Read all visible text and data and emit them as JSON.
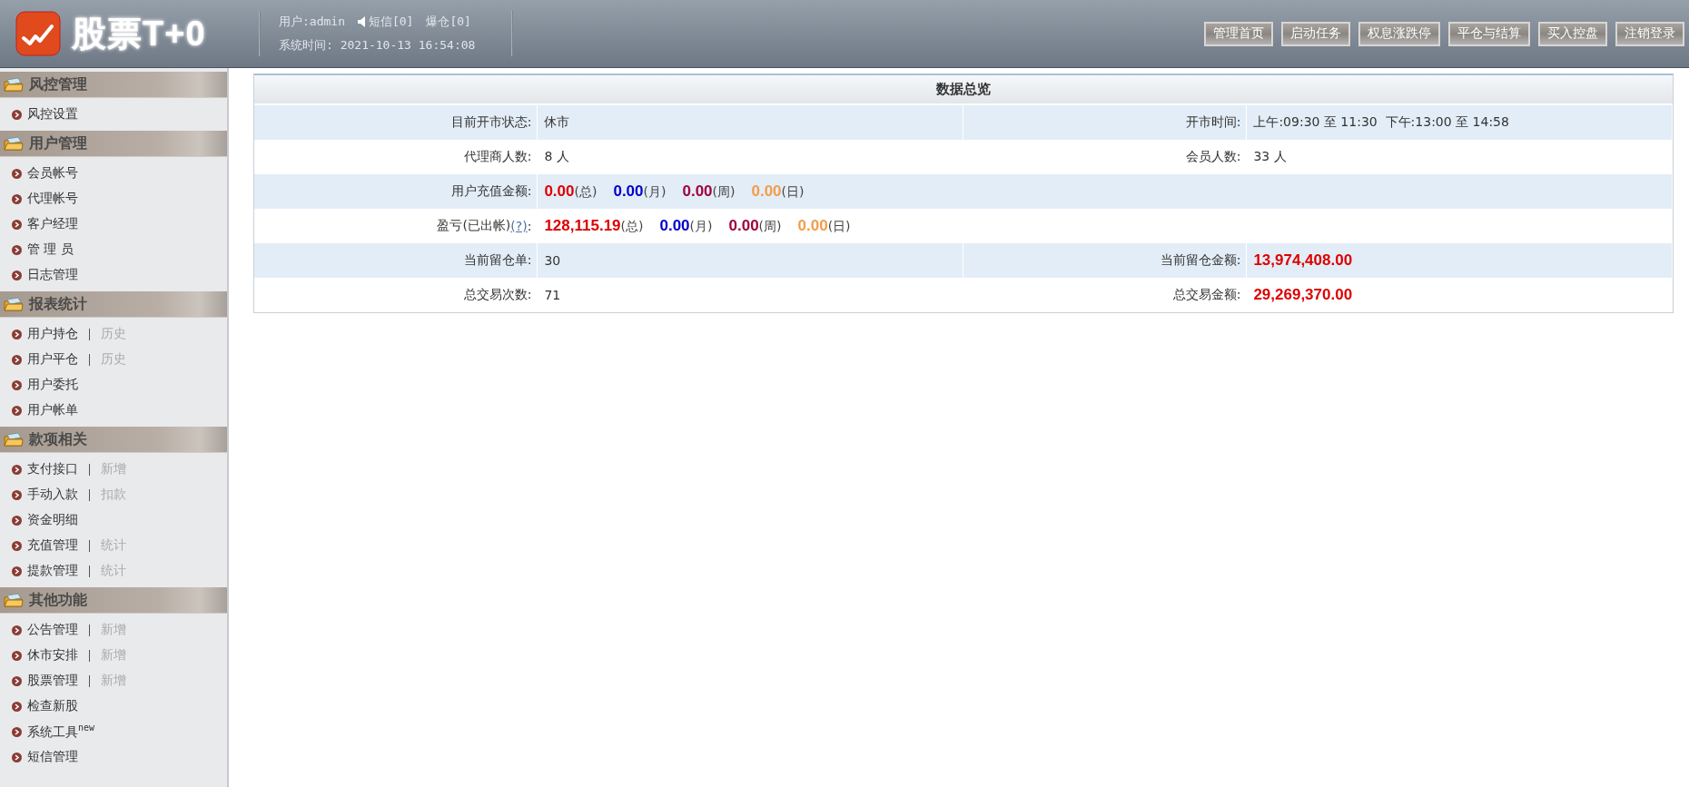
{
  "header": {
    "logo_text": "股票T+0",
    "user": "用户:admin",
    "messages": "短信[0]",
    "liquidations": "爆仓[0]",
    "system_time": "系统时间: 2021-10-13 16:54:08",
    "buttons": [
      "管理首页",
      "启动任务",
      "权息涨跌停",
      "平仓与结算",
      "买入控盘",
      "注销登录"
    ]
  },
  "sidebar": {
    "sections": [
      {
        "title": "风控管理",
        "items": [
          {
            "label": "风控设置"
          }
        ]
      },
      {
        "title": "用户管理",
        "items": [
          {
            "label": "会员帐号"
          },
          {
            "label": "代理帐号"
          },
          {
            "label": "客户经理"
          },
          {
            "label": "管 理 员"
          },
          {
            "label": "日志管理"
          }
        ]
      },
      {
        "title": "报表统计",
        "items": [
          {
            "label": "用户持仓",
            "extra": "历史"
          },
          {
            "label": "用户平仓",
            "extra": "历史"
          },
          {
            "label": "用户委托"
          },
          {
            "label": "用户帐单"
          }
        ]
      },
      {
        "title": "款项相关",
        "items": [
          {
            "label": "支付接口",
            "extra": "新增"
          },
          {
            "label": "手动入款",
            "extra": "扣款"
          },
          {
            "label": "资金明细"
          },
          {
            "label": "充值管理",
            "extra": "统计"
          },
          {
            "label": "提款管理",
            "extra": "统计"
          }
        ]
      },
      {
        "title": "其他功能",
        "items": [
          {
            "label": "公告管理",
            "extra": "新增"
          },
          {
            "label": "休市安排",
            "extra": "新增"
          },
          {
            "label": "股票管理",
            "extra": "新增"
          },
          {
            "label": "检查新股"
          },
          {
            "label": "系统工具$^{new}$"
          },
          {
            "label": "短信管理"
          }
        ]
      }
    ]
  },
  "overview": {
    "title": "数据总览",
    "rows": [
      {
        "kind": "pair",
        "cells": [
          {
            "label": "目前开市状态:",
            "value": {
              "kind": "text",
              "text": "休市"
            }
          },
          {
            "label": "开市时间:",
            "value": {
              "kind": "text",
              "text": "上午:09:30 至 11:30  下午:13:00 至 14:58"
            }
          }
        ]
      },
      {
        "kind": "pair",
        "cells": [
          {
            "label": "代理商人数:",
            "value": {
              "kind": "text",
              "text": "8 人"
            }
          },
          {
            "label": "会员人数:",
            "value": {
              "kind": "text",
              "text": "33 人"
            }
          }
        ]
      },
      {
        "kind": "wide",
        "cells": [
          {
            "label": "用户充值金额:",
            "value": {
              "kind": "amounts",
              "amounts": [
                {
                  "value": "0.00",
                  "unit": "(总)",
                  "color": "#dd0000"
                },
                {
                  "value": "0.00",
                  "unit": "(月)",
                  "color": "#0000cc"
                },
                {
                  "value": "0.00",
                  "unit": "(周)",
                  "color": "#a0003c"
                },
                {
                  "value": "0.00",
                  "unit": "(日)",
                  "color": "#f39c4a"
                }
              ]
            }
          }
        ]
      },
      {
        "kind": "wide",
        "cells": [
          {
            "label": "盈亏(已出帐)",
            "help": "(?)",
            "label_suffix": ":",
            "value": {
              "kind": "amounts",
              "amounts": [
                {
                  "value": "128,115.19",
                  "unit": "(总)",
                  "color": "#dd0000"
                },
                {
                  "value": "0.00",
                  "unit": "(月)",
                  "color": "#0000cc"
                },
                {
                  "value": "0.00",
                  "unit": "(周)",
                  "color": "#a0003c"
                },
                {
                  "value": "0.00",
                  "unit": "(日)",
                  "color": "#f39c4a"
                }
              ]
            }
          }
        ]
      },
      {
        "kind": "pair",
        "cells": [
          {
            "label": "当前留仓单:",
            "value": {
              "kind": "text",
              "text": "30"
            }
          },
          {
            "label": "当前留仓金额:",
            "value": {
              "kind": "amounts",
              "amounts": [
                {
                  "value": "13,974,408.00",
                  "color": "#dd0000"
                }
              ]
            }
          }
        ]
      },
      {
        "kind": "pair",
        "cells": [
          {
            "label": "总交易次数:",
            "value": {
              "kind": "text",
              "text": "71"
            }
          },
          {
            "label": "总交易金额:",
            "value": {
              "kind": "amounts",
              "amounts": [
                {
                  "value": "29,269,370.00",
                  "color": "#dd0000"
                }
              ]
            }
          }
        ]
      }
    ]
  }
}
